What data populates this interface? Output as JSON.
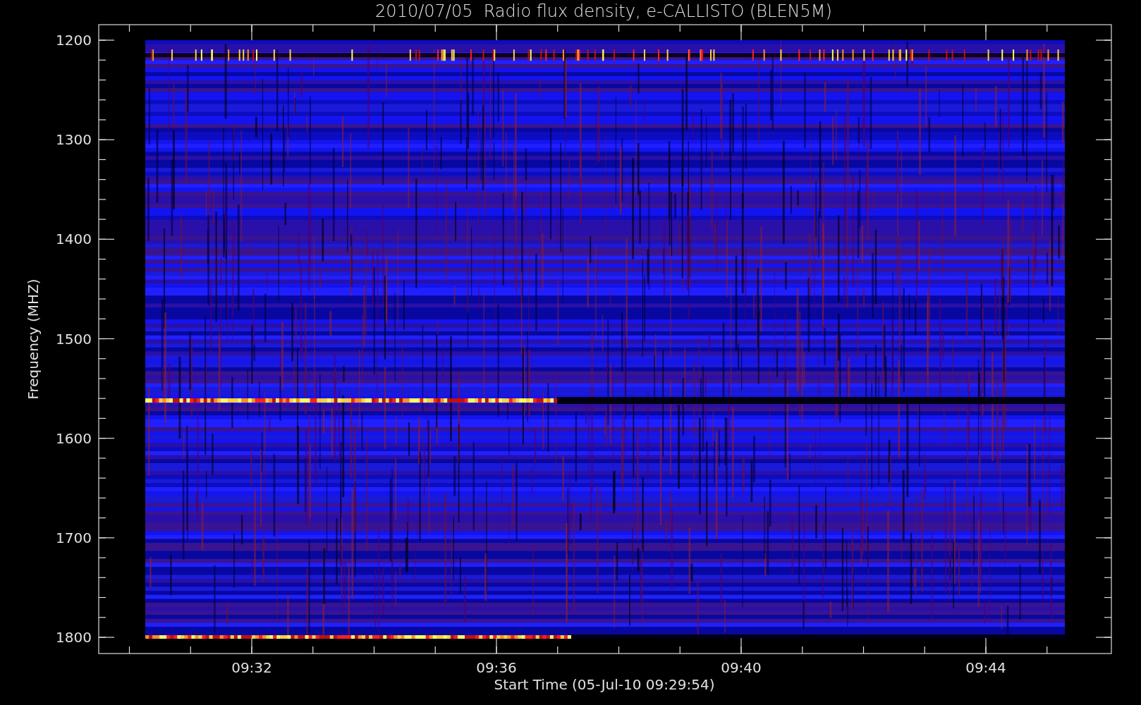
{
  "title": "2010/07/05  Radio flux density, e-CALLISTO (BLEN5M)",
  "y_axis": {
    "label": "Frequency (MHZ)",
    "ticks": [
      "1200",
      "1300",
      "1400",
      "1500",
      "1600",
      "1700",
      "1800"
    ]
  },
  "x_axis": {
    "label": "Start Time (05-Jul-10 09:29:54)",
    "ticks": [
      "09:32",
      "09:36",
      "09:40",
      "09:44"
    ]
  }
}
